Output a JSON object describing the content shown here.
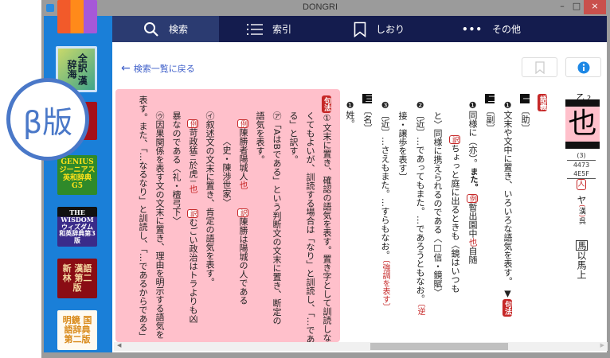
{
  "window": {
    "title": "DONGRI",
    "controls": {
      "minimize": "–",
      "maximize": "□",
      "close": "×"
    }
  },
  "badge": {
    "label": "β版",
    "color": "#4a78c8"
  },
  "sidebar": {
    "books": [
      {
        "name": "top-book",
        "label": ""
      },
      {
        "name": "kanjikai",
        "label": "全訳 漢辞海",
        "selected": true
      },
      {
        "name": "red-dictionary",
        "label": ""
      },
      {
        "name": "genius",
        "label": "GENIUS ジーニアス英和辞典 G5"
      },
      {
        "name": "wisdom",
        "label": "THE WISDOM ウィズダム 和英辞典第3版"
      },
      {
        "name": "kangorin",
        "label": "新 漢語林 第二版"
      },
      {
        "name": "meikyo",
        "label": "明鏡 国語辞典 第二版"
      }
    ]
  },
  "toolbar": {
    "tabs": [
      {
        "label": "検索",
        "icon": "search-icon",
        "active": true
      },
      {
        "label": "索引",
        "icon": "list-icon"
      },
      {
        "label": "しおり",
        "icon": "bookmark-icon"
      },
      {
        "label": "その他",
        "icon": "more-icon"
      }
    ]
  },
  "content": {
    "back_link": "検索一覧に戻る",
    "header": {
      "radical": "乙",
      "strokes": "2",
      "kanji": "也",
      "stroke_count": "(3)",
      "jis": "4473",
      "unicode": "4E5F",
      "jinmei": "人",
      "reading": "ヤ",
      "kan": "漢",
      "go": "呉",
      "example_box": "馬",
      "example": "以馬上"
    },
    "entry": {
      "gogi": "語義",
      "sec1": "一",
      "pos1": "〔助〕",
      "s1_num": "❶",
      "s1_text": "文末や文中に置き、いろいろな語気を表す。",
      "s1_arrow": "▼",
      "kuhou": "句法",
      "sec2": "二",
      "pos2": "〔副〕",
      "s2_num": "❶",
      "s2_text": "同様に（亦）。",
      "s2_mata": "また。",
      "rei": "例",
      "s2_ex1": "暫出",
      "s2_ex2": "園中",
      "s2_ya": "也",
      "s2_ex3": "自随",
      "yaku": "訳",
      "s2_tr1": "ちょっと庭に出るときも〈鏡はいつも",
      "s2_tr2": "と〉同様に携えられるのである〈□信・鏡賦〉",
      "s3_num": "❷",
      "s3_text": "〔近〕…であってもまた。…であろうともなお。",
      "s3_note1": "〔逆",
      "s3_note2": "接・譲歩を表す〕",
      "s4_num": "❸",
      "s4_text": "〔近〕…さえもまた。…すらもなお。",
      "s4_note": "〔強調を表す〕",
      "sec3": "三",
      "pos3": "〔名〕",
      "s5_num": "❶",
      "s5_text": "姓。"
    },
    "kuhou_box": {
      "badge": "句法",
      "lines": [
        "①文末に置き、確認の語気を表す。置き字として訓読しな",
        "くてもよいが、訓読する場合は「なり」と訓読し、「…であ",
        "る」と訳す。",
        "㋐「AはBである」という判断文の文末に置き、断定の",
        "語気を表す。"
      ],
      "ex1": {
        "rei": "例",
        "text": "陳勝者陽城人",
        "ya": "也",
        "yaku": "訳",
        "tr": "陳勝は陽城の人である",
        "src": "〈史・陳渉世家〉"
      },
      "line_i": "㋑叙述文の文末に置き、肯定の語気を表す。",
      "ex2": {
        "rei": "例",
        "text": "苛政猛",
        "kaeri1": "二",
        "text2": "於虎",
        "kaeri2": "一",
        "ya": "也",
        "yaku": "訳",
        "tr": "むごい政治はトラよりも凶",
        "tr2": "暴なのである〈礼・檀弓下〉"
      },
      "line_u": "㋒因果関係を表す文の文末に置き、理由を明示する語気を",
      "line_u2": "表す。また、「…なるなり」と訓読し、「…であるからである」"
    }
  },
  "colors": {
    "toolbar": "#141c4e",
    "sidebar": "#1a7fd8",
    "pink": "#ffc0cb",
    "accent_red": "#c62828",
    "link": "#3b5cc8"
  }
}
